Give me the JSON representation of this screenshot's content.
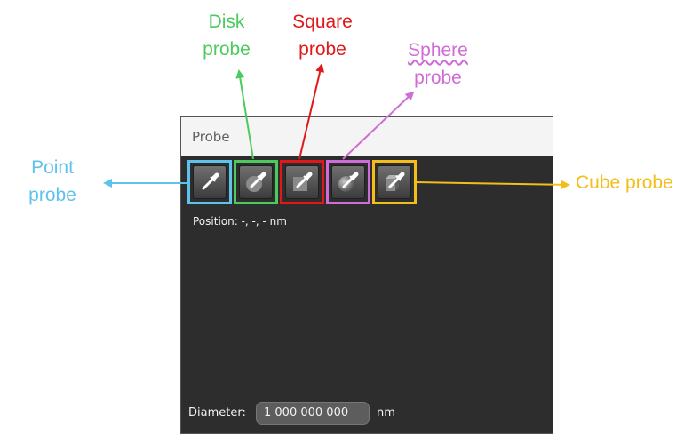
{
  "callouts": {
    "disk": [
      "Disk",
      "probe"
    ],
    "square": [
      "Square",
      "probe"
    ],
    "sphere": [
      "Sphere",
      "probe"
    ],
    "point": [
      "Point",
      "probe"
    ],
    "cube": "Cube probe"
  },
  "colors": {
    "point": "#5ec3ec",
    "disk": "#4ccb5c",
    "square": "#e01818",
    "sphere": "#d06cd6",
    "cube": "#f3bd1a"
  },
  "panel": {
    "title": "Probe",
    "tools": [
      {
        "name": "point-probe",
        "icon": "pipette-icon"
      },
      {
        "name": "disk-probe",
        "icon": "pipette-disk-icon"
      },
      {
        "name": "square-probe",
        "icon": "pipette-square-icon"
      },
      {
        "name": "sphere-probe",
        "icon": "pipette-sphere-icon"
      },
      {
        "name": "cube-probe",
        "icon": "pipette-cube-icon"
      }
    ],
    "position_text": "Position: -, -, - nm",
    "diameter_label": "Diameter:",
    "diameter_value": "1 000 000 000",
    "diameter_unit": "nm"
  }
}
